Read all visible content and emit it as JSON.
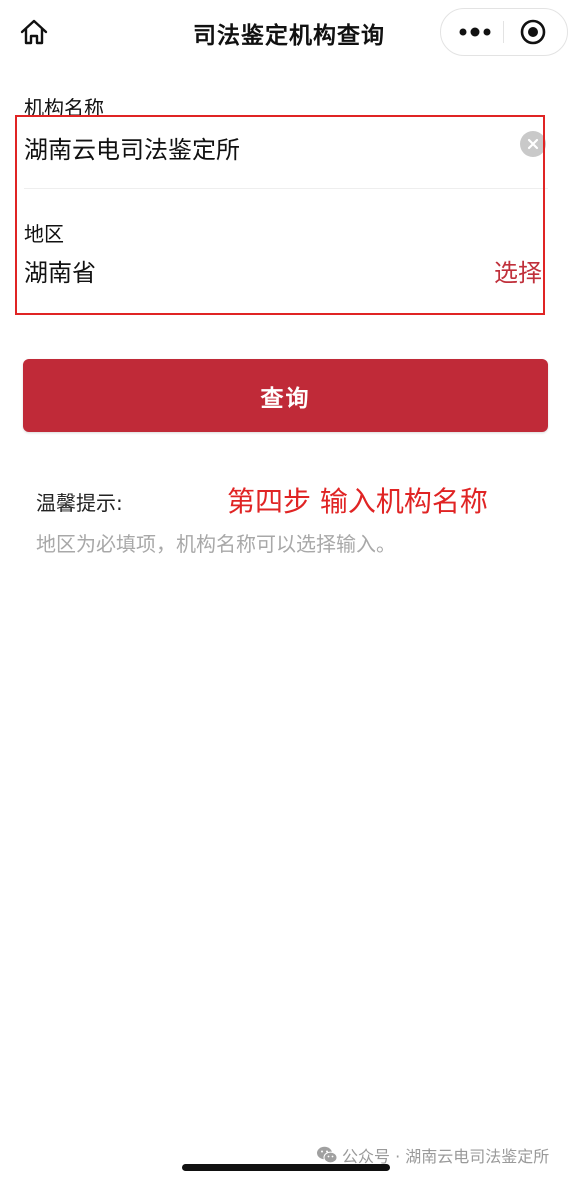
{
  "header": {
    "title": "司法鉴定机构查询",
    "home_icon": "home-icon",
    "more_icon": "more-dots-icon",
    "close_icon": "miniprogram-close-icon"
  },
  "form": {
    "org_name": {
      "label": "机构名称",
      "value": "湖南云电司法鉴定所"
    },
    "region": {
      "label": "地区",
      "value": "湖南省",
      "select_label": "选择"
    }
  },
  "query_button": {
    "label": "查询"
  },
  "tips": {
    "title": "温馨提示:",
    "text": "地区为必填项，机构名称可以选择输入。"
  },
  "annotation": {
    "text": "第四步  输入机构名称"
  },
  "watermark": {
    "text": "公众号 · 湖南云电司法鉴定所",
    "icon": "wechat-icon"
  },
  "colors": {
    "accent": "#c02a38",
    "annotation_red": "#e02424",
    "hint_gray": "#a8a8a8"
  }
}
